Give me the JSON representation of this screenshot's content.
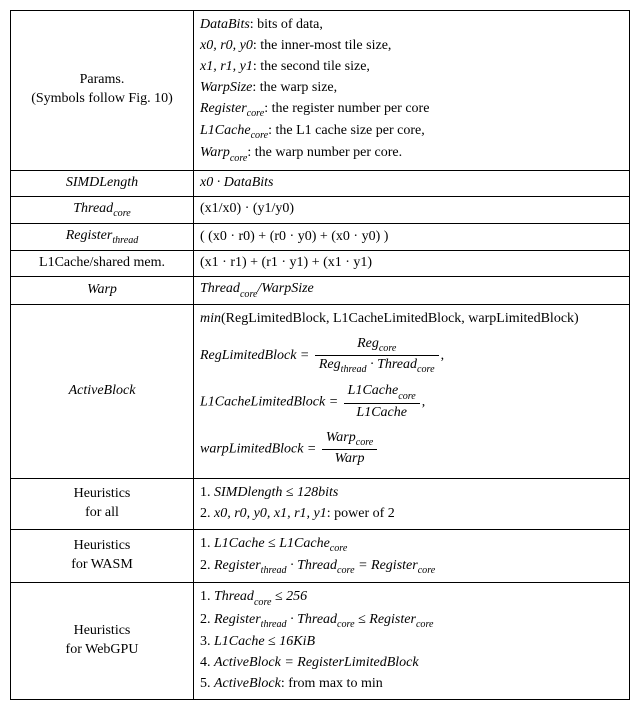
{
  "params": {
    "label_l1": "Params.",
    "label_l2": "(Symbols follow Fig. 10)",
    "defs": {
      "databits_sym": "DataBits",
      "databits_txt": ": bits of data,",
      "inner_syms": "x0, r0, y0",
      "inner_txt": ": the inner-most tile size,",
      "second_syms": "x1, r1, y1",
      "second_txt": ": the second tile size,",
      "warpsize_sym": "WarpSize",
      "warpsize_txt": ": the warp size,",
      "regcore_sym": "Register",
      "regcore_sub": "core",
      "regcore_txt": ": the register number per core",
      "l1core_sym": "L1Cache",
      "l1core_sub": "core",
      "l1core_txt": ": the L1 cache size per core,",
      "warpcore_sym": "Warp",
      "warpcore_sub": "core",
      "warpcore_txt": ": the warp number per core."
    }
  },
  "simd": {
    "label": "SIMDLength",
    "def_a": "x0 · DataBits"
  },
  "threadcore": {
    "label_sym": "Thread",
    "label_sub": "core",
    "def": "(x1/x0) · (y1/y0)"
  },
  "regthread": {
    "label_sym": "Register",
    "label_sub": "thread",
    "def": "( (x0 · r0) + (r0 · y0) + (x0 · y0) )"
  },
  "l1shared": {
    "label": "L1Cache/shared mem.",
    "def": "(x1 · r1) + (r1 · y1) + (x1 · y1)"
  },
  "warprow": {
    "label": "Warp",
    "def_a": "Thread",
    "def_a_sub": "core",
    "def_b": "/WarpSize"
  },
  "activeblock": {
    "label": "ActiveBlock",
    "line1_a": "min",
    "line1_b": "(RegLimitedBlock, L1CacheLimitedBlock, warpLimitedBlock)",
    "reg_lhs": "RegLimitedBlock = ",
    "reg_num_a": "Reg",
    "reg_num_sub": "core",
    "reg_den_a": "Reg",
    "reg_den_a_sub": "thread",
    "reg_den_mid": " · Thread",
    "reg_den_b_sub": "core",
    "reg_tail": ",",
    "l1_lhs": "L1CacheLimitedBlock = ",
    "l1_num_a": "L1Cache",
    "l1_num_sub": "core",
    "l1_den": "L1Cache",
    "l1_tail": ",",
    "warp_lhs": "warpLimitedBlock = ",
    "warp_num_a": "Warp",
    "warp_num_sub": "core",
    "warp_den": "Warp"
  },
  "heur_all": {
    "label_l1": "Heuristics",
    "label_l2": "for all",
    "r1_a": "1. ",
    "r1_b": "SIMDlength ≤ 128bits",
    "r2_a": "2. ",
    "r2_b": "x0, r0, y0, x1, r1, y1",
    "r2_c": ": power of 2"
  },
  "heur_wasm": {
    "label_l1": "Heuristics",
    "label_l2": "for WASM",
    "r1_a": "1. ",
    "r1_b": "L1Cache ≤ L1Cache",
    "r1_sub": "core",
    "r2_a": "2. ",
    "r2_b": "Register",
    "r2_b_sub": "thread",
    "r2_c": " · Thread",
    "r2_c_sub": "core",
    "r2_d": " = Register",
    "r2_d_sub": "core"
  },
  "heur_webgpu": {
    "label_l1": "Heuristics",
    "label_l2": "for WebGPU",
    "r1_a": "1. ",
    "r1_b": "Thread",
    "r1_sub": "core",
    "r1_c": " ≤ 256",
    "r2_a": "2. ",
    "r2_b": "Register",
    "r2_b_sub": "thread",
    "r2_c": " · Thread",
    "r2_c_sub": "core",
    "r2_d": " ≤ Register",
    "r2_d_sub": "core",
    "r3_a": "3. ",
    "r3_b": "L1Cache ≤ 16KiB",
    "r4_a": "4. ",
    "r4_b": "ActiveBlock = RegisterLimitedBlock",
    "r5_a": "5. ",
    "r5_b": "ActiveBlock",
    "r5_c": ": from max to min"
  }
}
